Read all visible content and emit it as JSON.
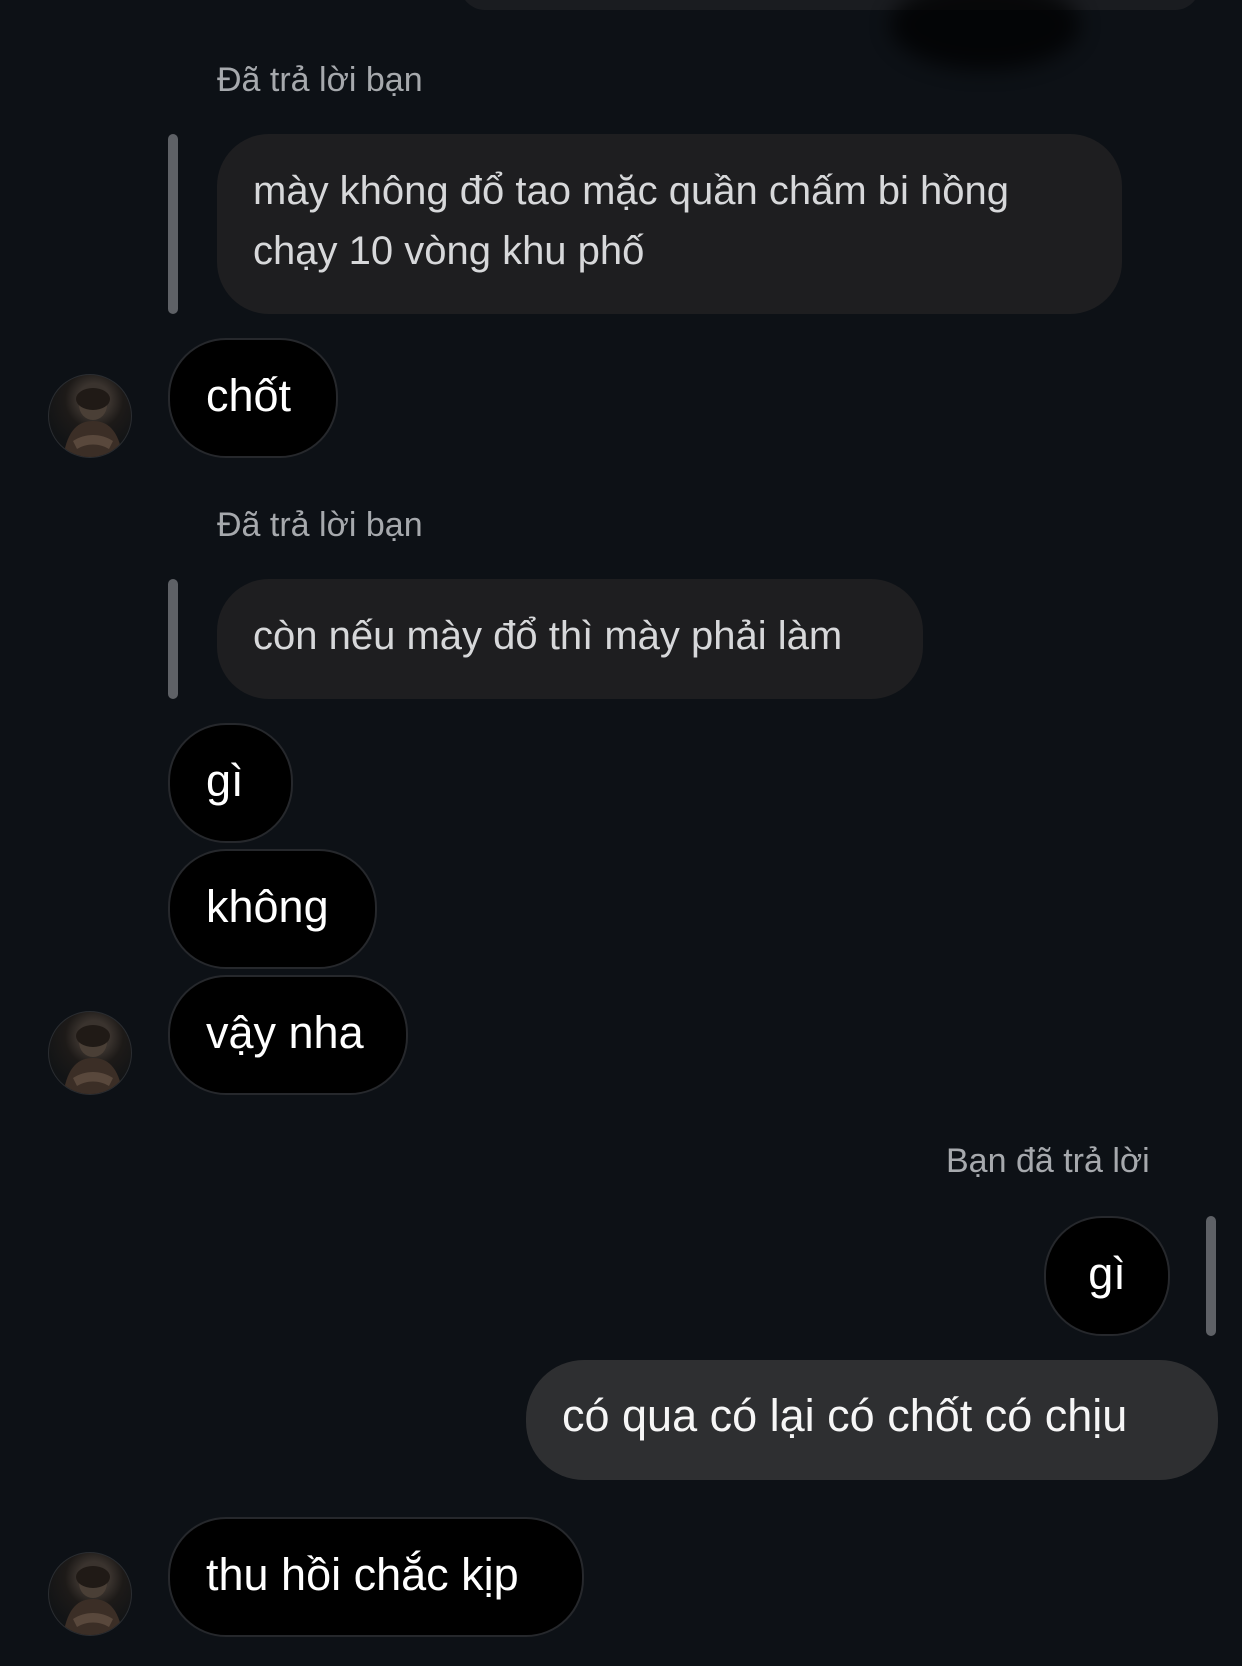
{
  "conversation": {
    "reply_caption_1": "Đã trả lời bạn",
    "quoted_1": "mày không đổ tao mặc quần chấm bi hồng chạy 10 vòng khu phố",
    "msg_1": "chốt",
    "reply_caption_2": "Đã trả lời bạn",
    "quoted_2": "còn nếu mày đổ thì mày phải làm",
    "msg_2": "gì",
    "msg_3": "không",
    "msg_4": "vậy nha",
    "reply_caption_3": "Bạn đã trả lời",
    "quoted_3": "gì",
    "msg_5": "có qua có lại có chốt có chịu",
    "msg_6": "thu hồi chắc kịp"
  },
  "icons": {
    "avatar": "contact-avatar-photo"
  },
  "colors": {
    "background": "#0d1116",
    "incoming_bubble": "#000000",
    "outgoing_bubble": "#2e2f31",
    "quoted_bubble": "#1e1e20",
    "reply_bar": "#5e6166",
    "caption_text": "#a6a9ad"
  }
}
